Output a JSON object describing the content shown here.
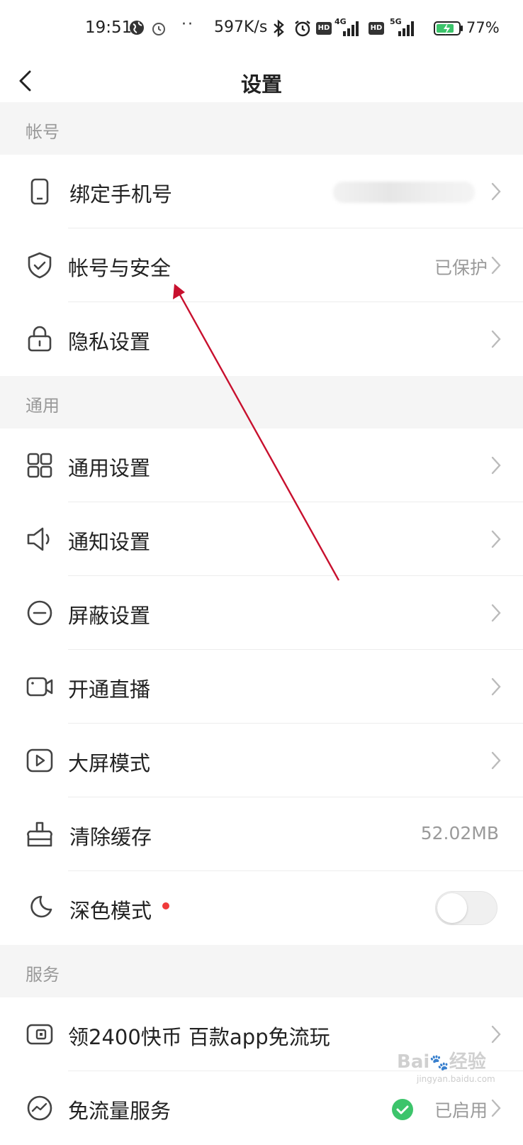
{
  "status_bar": {
    "time": "19:51",
    "dots": "··",
    "speed": "597K/s",
    "hd1": "HD",
    "net1": "4G",
    "hd2": "HD",
    "net2": "5G",
    "battery_pct": "77%"
  },
  "navbar": {
    "back_icon": "chevron-left-icon",
    "title": "设置"
  },
  "sections": [
    {
      "header": "帐号"
    },
    {
      "header": "通用"
    },
    {
      "header": "服务"
    }
  ],
  "rows": {
    "bind_phone": {
      "label": "绑定手机号",
      "icon": "phone-icon"
    },
    "account_security": {
      "label": "帐号与安全",
      "value": "已保护",
      "icon": "shield-icon"
    },
    "privacy": {
      "label": "隐私设置",
      "icon": "lock-icon"
    },
    "general": {
      "label": "通用设置",
      "icon": "grid-icon"
    },
    "notification": {
      "label": "通知设置",
      "icon": "speaker-icon"
    },
    "block": {
      "label": "屏蔽设置",
      "icon": "minus-circle-icon"
    },
    "live": {
      "label": "开通直播",
      "icon": "video-camera-icon"
    },
    "big_screen": {
      "label": "大屏模式",
      "icon": "play-icon"
    },
    "clear_cache": {
      "label": "清除缓存",
      "value": "52.02MB",
      "icon": "broom-icon"
    },
    "dark_mode": {
      "label": "深色模式",
      "icon": "moon-icon",
      "enabled": false
    },
    "coins": {
      "label": "领2400快币 百款app免流玩",
      "icon": "wallet-icon"
    },
    "free_data": {
      "label": "免流量服务",
      "value": "已启用",
      "icon": "trend-circle-icon"
    }
  },
  "annotation": {
    "color": "#c8102e"
  },
  "watermark": {
    "text": "Bai",
    "text2": "经验",
    "sub": "jingyan.baidu.com"
  },
  "colors": {
    "accent_check": "#3cc46b",
    "red_dot": "#f03a3a"
  }
}
